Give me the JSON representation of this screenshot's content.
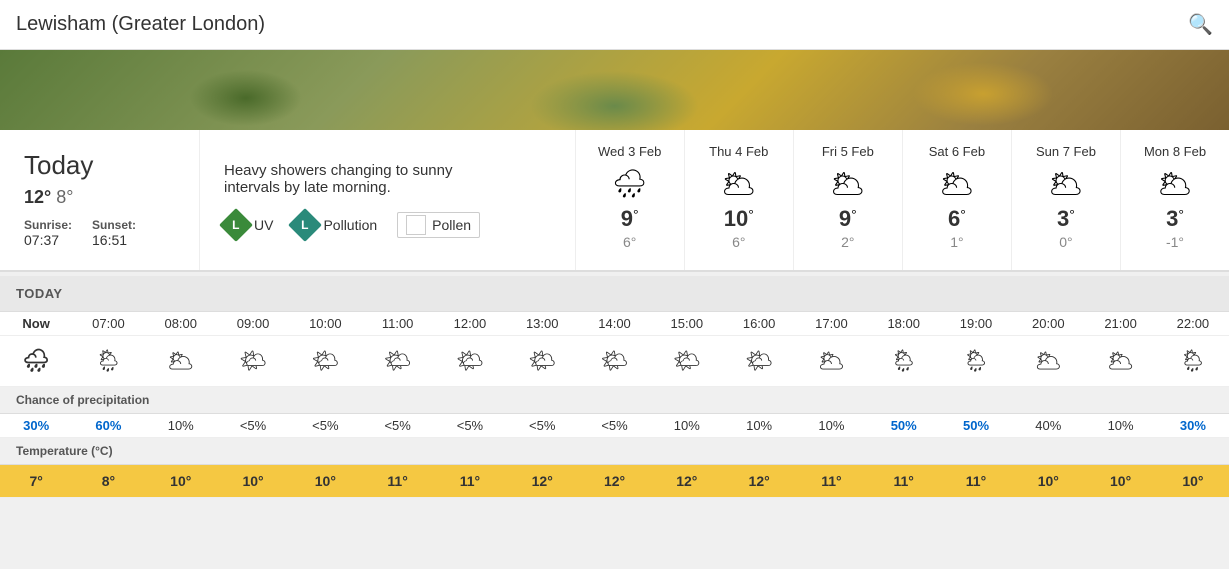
{
  "header": {
    "title": "Lewisham (Greater London)",
    "search_label": "search"
  },
  "today": {
    "label": "Today",
    "high": "12°",
    "low": "8°",
    "description": "Heavy showers changing to sunny intervals by late morning.",
    "sunrise_label": "Sunrise:",
    "sunrise": "07:37",
    "sunset_label": "Sunset:",
    "sunset": "16:51",
    "uv_label": "UV",
    "uv_level": "L",
    "pollution_label": "Pollution",
    "pollution_level": "L",
    "pollen_label": "Pollen"
  },
  "forecast": [
    {
      "date": "Wed 3 Feb",
      "icon": "🌧",
      "high": "9°",
      "low": "6°"
    },
    {
      "date": "Thu 4 Feb",
      "icon": "🌥",
      "high": "10°",
      "low": "6°"
    },
    {
      "date": "Fri 5 Feb",
      "icon": "🌥",
      "high": "9°",
      "low": "2°"
    },
    {
      "date": "Sat 6 Feb",
      "icon": "🌥",
      "high": "6°",
      "low": "1°"
    },
    {
      "date": "Sun 7 Feb",
      "icon": "🌥",
      "high": "3°",
      "low": "0°"
    },
    {
      "date": "Mon 8 Feb",
      "icon": "🌥",
      "high": "3°",
      "low": "-1°"
    }
  ],
  "hourly_section": {
    "label": "TODAY",
    "times": [
      "Now",
      "07:00",
      "08:00",
      "09:00",
      "10:00",
      "11:00",
      "12:00",
      "13:00",
      "14:00",
      "15:00",
      "16:00",
      "17:00",
      "18:00",
      "19:00",
      "20:00",
      "21:00",
      "22:00"
    ],
    "icons": [
      "🌧",
      "🌦",
      "🌥",
      "🌤",
      "🌤",
      "🌤",
      "🌤",
      "🌤",
      "🌤",
      "🌤",
      "🌤",
      "🌥",
      "🌦",
      "🌦",
      "🌥",
      "🌥",
      "🌦"
    ],
    "chance_label": "Chance of precipitation",
    "chances": [
      "30%",
      "60%",
      "10%",
      "<5%",
      "<5%",
      "<5%",
      "<5%",
      "<5%",
      "<5%",
      "10%",
      "10%",
      "10%",
      "50%",
      "50%",
      "40%",
      "10%",
      "30%"
    ],
    "chance_colors": [
      "blue",
      "blue",
      "normal",
      "normal",
      "normal",
      "normal",
      "normal",
      "normal",
      "normal",
      "normal",
      "normal",
      "normal",
      "blue",
      "blue",
      "normal",
      "normal",
      "blue"
    ],
    "temp_label": "Temperature (°C)",
    "temps": [
      "7°",
      "8°",
      "10°",
      "10°",
      "10°",
      "11°",
      "11°",
      "12°",
      "12°",
      "12°",
      "12°",
      "11°",
      "11°",
      "11°",
      "10°",
      "10°",
      "10°"
    ]
  }
}
